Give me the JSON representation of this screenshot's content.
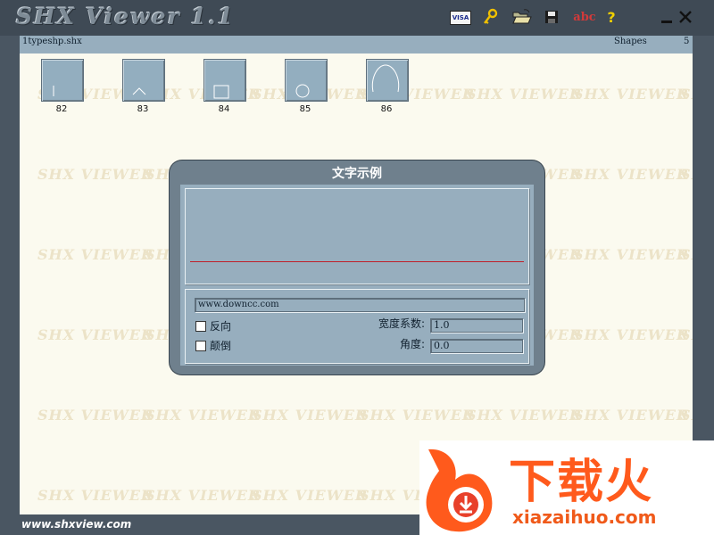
{
  "app": {
    "title": "SHX Viewer 1.1",
    "file_name": "1typeshp.shx",
    "shapes_label": "Shapes",
    "shape_count": "5",
    "website": "www.shxview.com",
    "watermark_text": "SHX VIEWER"
  },
  "toolbar": {
    "visa_label": "VISA",
    "spell_label": "abc",
    "help_label": "?",
    "icons": [
      "visa-card-icon",
      "key-icon",
      "open-folder-icon",
      "save-disk-icon",
      "spell-check-icon",
      "help-icon",
      "minimize-icon",
      "close-icon"
    ]
  },
  "shapes": [
    {
      "id": "82",
      "glyph": "vertical-line"
    },
    {
      "id": "83",
      "glyph": "caret"
    },
    {
      "id": "84",
      "glyph": "square"
    },
    {
      "id": "85",
      "glyph": "circle"
    },
    {
      "id": "86",
      "glyph": "arch"
    }
  ],
  "dialog": {
    "title": "文字示例",
    "sample_text": "www.downcc.com",
    "reverse_label": "反向",
    "reverse_checked": false,
    "invert_label": "颠倒",
    "invert_checked": false,
    "width_factor_label": "宽度系数:",
    "width_factor_value": "1.0",
    "angle_label": "角度:",
    "angle_value": "0.0"
  },
  "logo": {
    "text": "下载火",
    "sub": "xiazaihuo.com"
  },
  "colors": {
    "frame": "#4a5662",
    "panel": "#97aebe",
    "canvas": "#fbfaef",
    "accent_line": "#c0202a",
    "logo_orange": "#ff5a1c"
  }
}
